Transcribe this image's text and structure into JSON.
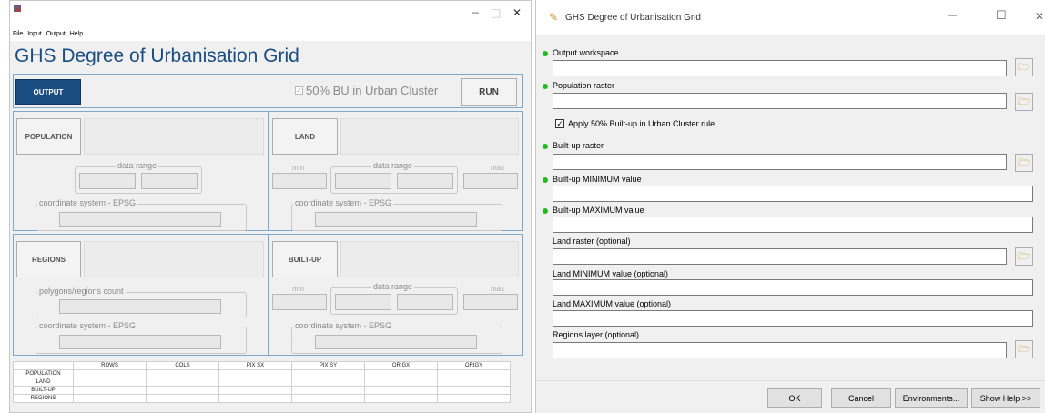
{
  "left_window": {
    "menu": [
      "File",
      "Input",
      "Output",
      "Help"
    ],
    "controls": {
      "minimize": "−",
      "maximize": "□",
      "close": "✕"
    },
    "app_title": "GHS Degree of Urbanisation Grid",
    "output_button": "OUTPUT",
    "checkbox_label": "50% BU in Urban Cluster",
    "checkbox_checked": true,
    "run_button": "RUN",
    "population": {
      "button": "POPULATION",
      "data_range": "data range",
      "crs": "coordinate system - EPSG"
    },
    "land": {
      "button": "LAND",
      "min": "min",
      "data_range": "data range",
      "max": "max",
      "crs": "coordinate system - EPSG"
    },
    "regions": {
      "button": "REGIONS",
      "count": "polygons/regions count",
      "crs": "coordinate system - EPSG"
    },
    "builtup": {
      "button": "BUILT-UP",
      "min": "min",
      "data_range": "data range",
      "max": "max",
      "crs": "coordinate system - EPSG"
    },
    "table": {
      "columns": [
        "ROWS",
        "COLS",
        "PIX SX",
        "PIX SY",
        "ORIGX",
        "ORIGY"
      ],
      "rows": [
        "POPULATION",
        "LAND",
        "BUILT-UP",
        "REGIONS"
      ]
    }
  },
  "right_window": {
    "title": "GHS Degree of Urbanisation Grid",
    "controls": {
      "minimize": "—",
      "maximize": "☐",
      "close": "✕"
    },
    "fields": {
      "output_workspace": "Output workspace",
      "population_raster": "Population raster",
      "apply_rule": "Apply 50% Built-up in Urban Cluster rule",
      "builtup_raster": "Built-up raster",
      "builtup_min": "Built-up MINIMUM value",
      "builtup_max": "Built-up MAXIMUM value",
      "land_raster": "Land raster (optional)",
      "land_min": "Land MINIMUM value (optional)",
      "land_max": "Land MAXIMUM value (optional)",
      "regions_layer": "Regions layer (optional)"
    },
    "buttons": {
      "ok": "OK",
      "cancel": "Cancel",
      "environments": "Environments...",
      "show_help": "Show Help >>"
    }
  },
  "colors": {
    "accent": "#1a4d80",
    "panel_border": "#7fa7c9",
    "required_dot": "#22bb22"
  }
}
